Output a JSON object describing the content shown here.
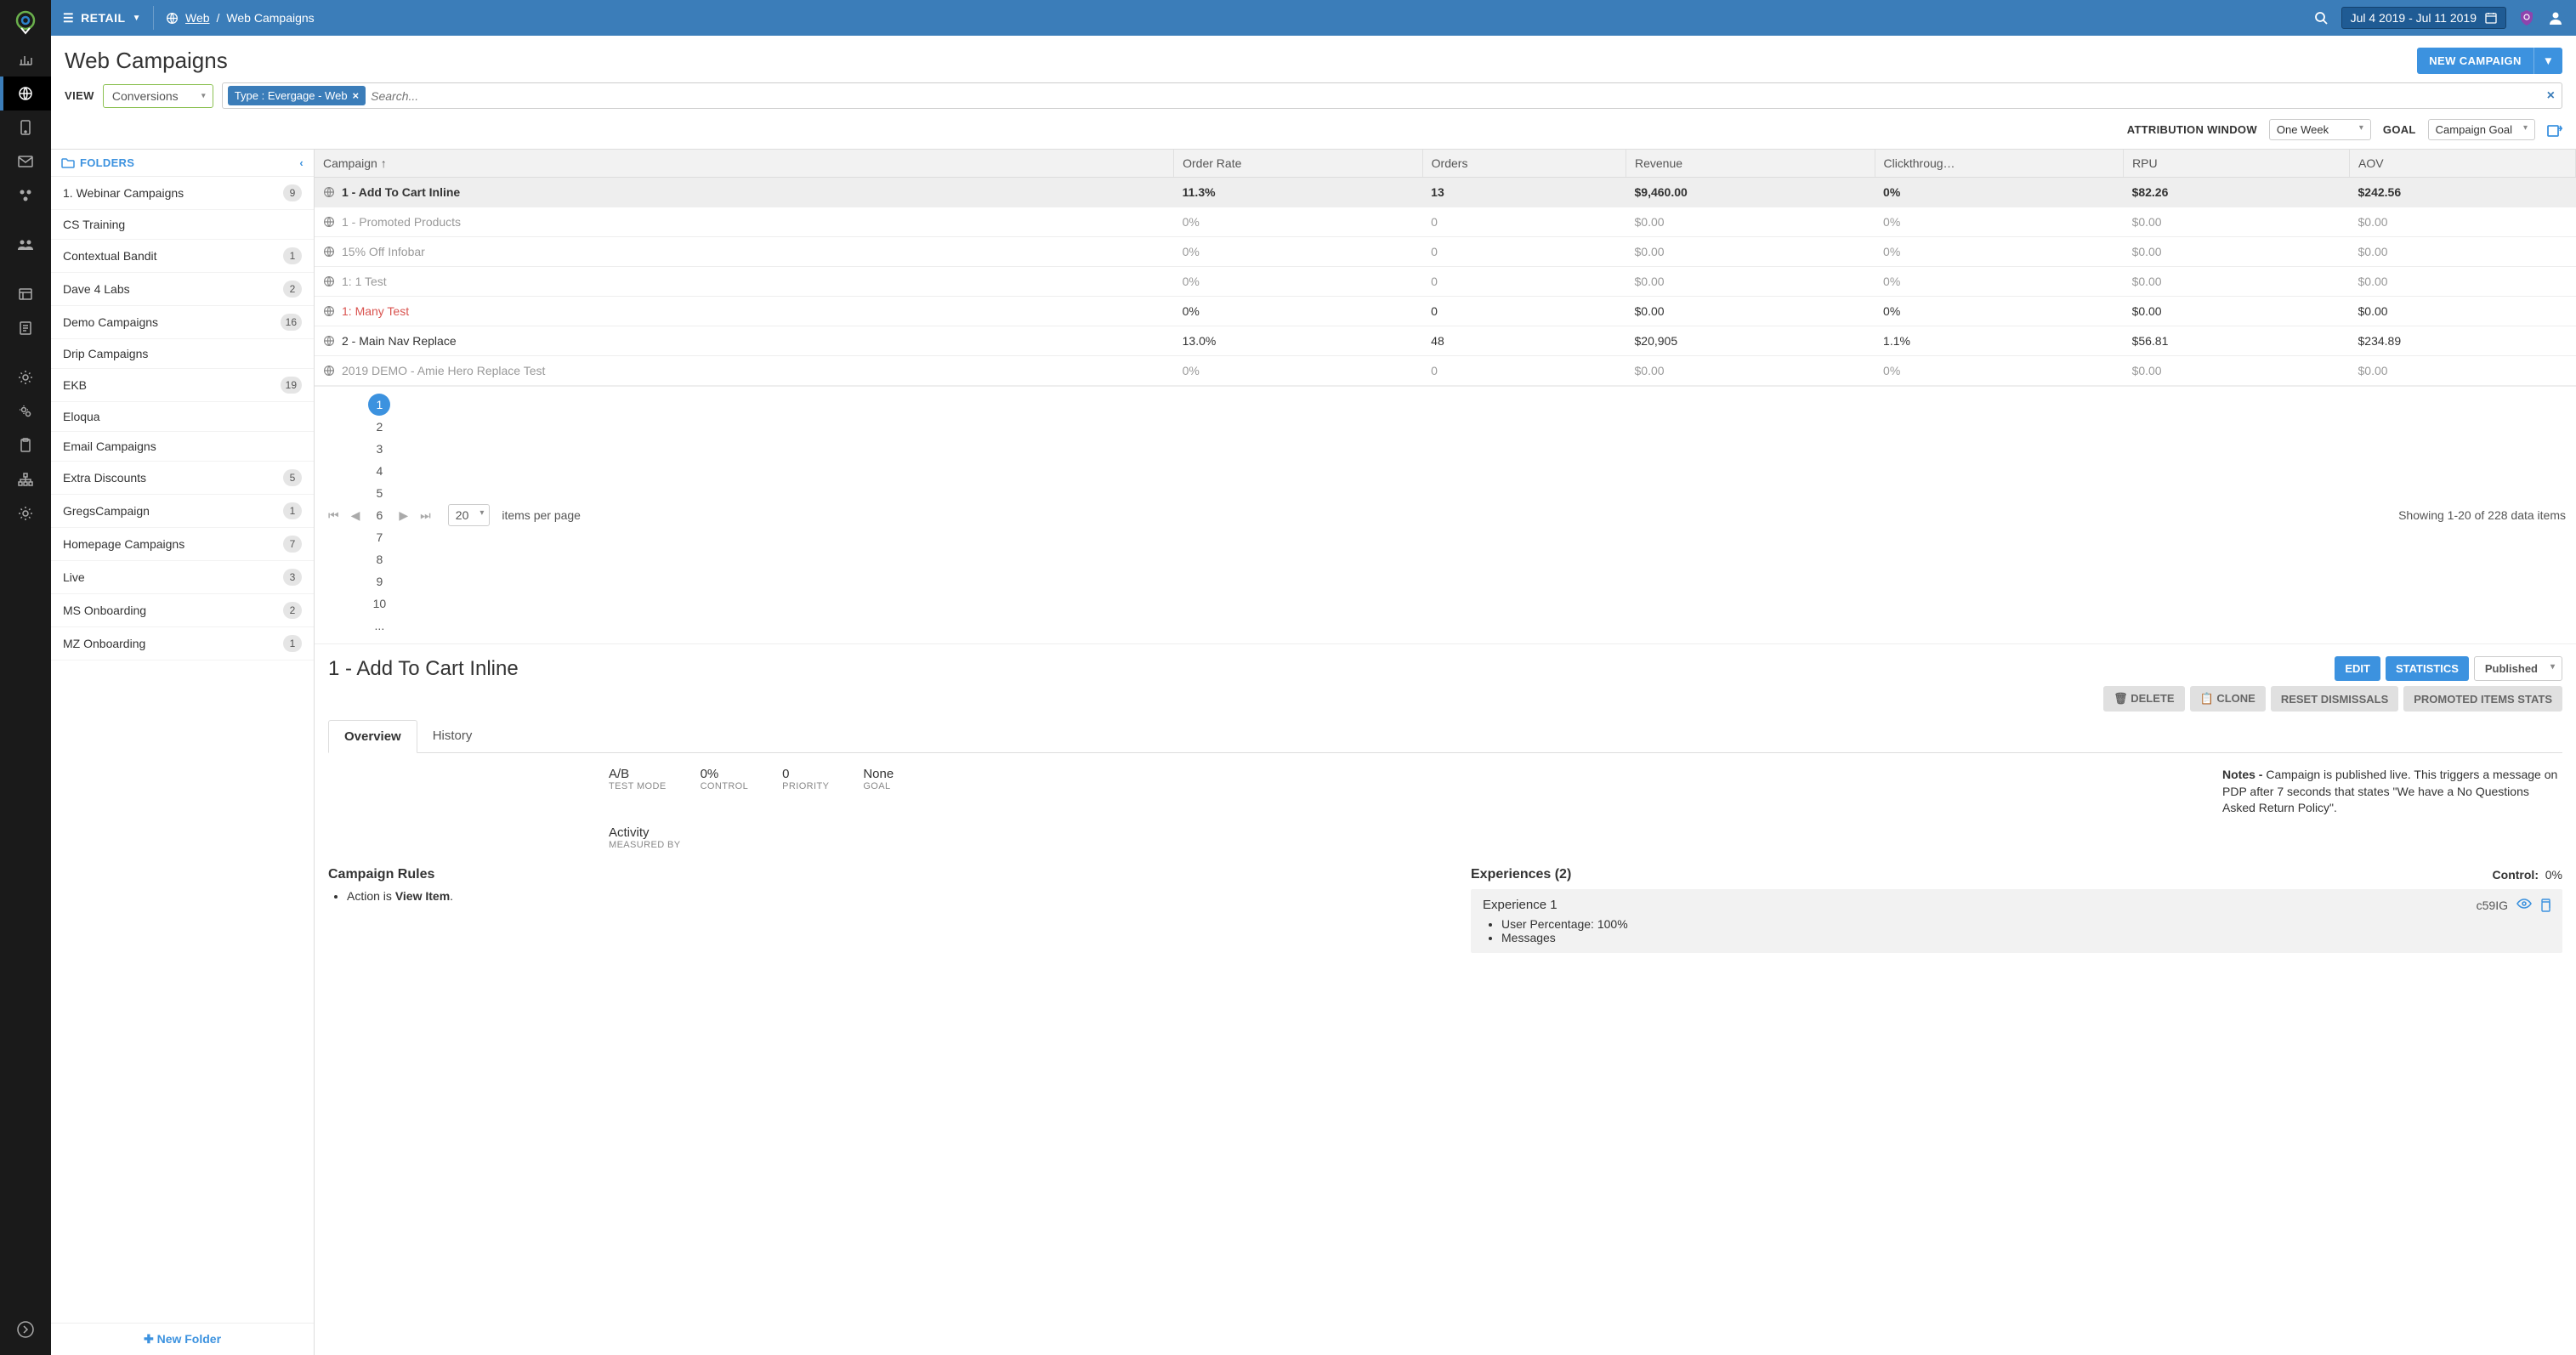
{
  "topbar": {
    "dataset": "RETAIL",
    "crumb_root": "Web",
    "crumb_current": "Web Campaigns",
    "date_range": "Jul 4 2019 - Jul 11 2019"
  },
  "page": {
    "title": "Web Campaigns",
    "new_campaign": "NEW CAMPAIGN"
  },
  "filter": {
    "view_label": "VIEW",
    "view_value": "Conversions",
    "pill": "Type : Evergage - Web",
    "search_placeholder": "Search..."
  },
  "controls": {
    "attr_label": "ATTRIBUTION WINDOW",
    "attr_value": "One Week",
    "goal_label": "GOAL",
    "goal_value": "Campaign Goal"
  },
  "folders_header": "FOLDERS",
  "folders": [
    {
      "name": "1. Webinar Campaigns",
      "count": "9"
    },
    {
      "name": "CS Training",
      "count": ""
    },
    {
      "name": "Contextual Bandit",
      "count": "1"
    },
    {
      "name": "Dave 4 Labs",
      "count": "2"
    },
    {
      "name": "Demo Campaigns",
      "count": "16"
    },
    {
      "name": "Drip Campaigns",
      "count": ""
    },
    {
      "name": "EKB",
      "count": "19"
    },
    {
      "name": "Eloqua",
      "count": ""
    },
    {
      "name": "Email Campaigns",
      "count": ""
    },
    {
      "name": "Extra Discounts",
      "count": "5"
    },
    {
      "name": "GregsCampaign",
      "count": "1"
    },
    {
      "name": "Homepage Campaigns",
      "count": "7"
    },
    {
      "name": "Live",
      "count": "3"
    },
    {
      "name": "MS Onboarding",
      "count": "2"
    },
    {
      "name": "MZ Onboarding",
      "count": "1"
    }
  ],
  "new_folder": "New Folder",
  "table": {
    "cols": [
      "Campaign ↑",
      "Order Rate",
      "Orders",
      "Revenue",
      "Clickthroug…",
      "RPU",
      "AOV"
    ],
    "rows": [
      {
        "name": "1 - Add To Cart Inline",
        "vals": [
          "11.3%",
          "13",
          "$9,460.00",
          "0%",
          "$82.26",
          "$242.56"
        ],
        "cls": "selected"
      },
      {
        "name": "1 - Promoted Products",
        "vals": [
          "0%",
          "0",
          "$0.00",
          "0%",
          "$0.00",
          "$0.00"
        ],
        "cls": "dim"
      },
      {
        "name": "15% Off Infobar",
        "vals": [
          "0%",
          "0",
          "$0.00",
          "0%",
          "$0.00",
          "$0.00"
        ],
        "cls": "dim"
      },
      {
        "name": "1: 1 Test",
        "vals": [
          "0%",
          "0",
          "$0.00",
          "0%",
          "$0.00",
          "$0.00"
        ],
        "cls": "dim"
      },
      {
        "name": "1: Many Test",
        "vals": [
          "0%",
          "0",
          "$0.00",
          "0%",
          "$0.00",
          "$0.00"
        ],
        "cls": "err"
      },
      {
        "name": "2 - Main Nav Replace",
        "vals": [
          "13.0%",
          "48",
          "$20,905",
          "1.1%",
          "$56.81",
          "$234.89"
        ],
        "cls": ""
      },
      {
        "name": "2019 DEMO - Amie Hero Replace Test",
        "vals": [
          "0%",
          "0",
          "$0.00",
          "0%",
          "$0.00",
          "$0.00"
        ],
        "cls": "dim"
      }
    ]
  },
  "pager": {
    "pages": [
      "1",
      "2",
      "3",
      "4",
      "5",
      "6",
      "7",
      "8",
      "9",
      "10",
      "..."
    ],
    "per_page": "20",
    "per_page_label": "items per page",
    "status": "Showing 1-20 of 228 data items"
  },
  "detail": {
    "title": "1 - Add To Cart Inline",
    "btn_edit": "EDIT",
    "btn_stats": "STATISTICS",
    "state_value": "Published",
    "btn_delete": "DELETE",
    "btn_clone": "CLONE",
    "btn_reset": "RESET DISMISSALS",
    "btn_promo": "PROMOTED ITEMS STATS",
    "tabs": {
      "overview": "Overview",
      "history": "History"
    },
    "stats": {
      "testmode_v": "A/B",
      "testmode_l": "TEST MODE",
      "control_v": "0%",
      "control_l": "CONTROL",
      "priority_v": "0",
      "priority_l": "PRIORITY",
      "goal_v": "None",
      "goal_l": "GOAL",
      "measured_v": "Activity",
      "measured_l": "MEASURED BY"
    },
    "notes_label": "Notes -",
    "notes_body": "Campaign is published live. This triggers a message on PDP after 7 seconds that states \"We have a No Questions Asked Return Policy\".",
    "rules_title": "Campaign Rules",
    "rule_prefix": "Action is ",
    "rule_value": "View Item",
    "exp_title": "Experiences (2)",
    "exp_control_label": "Control:",
    "exp_control_value": "0%",
    "exp1_name": "Experience 1",
    "exp1_code": "c59IG",
    "exp1_li1": "User Percentage: 100%",
    "exp1_li2": "Messages"
  }
}
